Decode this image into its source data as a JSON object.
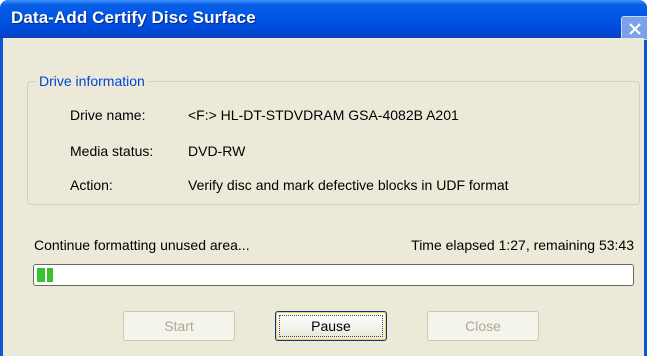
{
  "window": {
    "title": "Data-Add Certify Disc Surface"
  },
  "drive_info": {
    "legend": "Drive information",
    "drive_name_label": "Drive name:",
    "drive_name_value": "<F:> HL-DT-STDVDRAM GSA-4082B A201",
    "media_status_label": "Media status:",
    "media_status_value": "DVD-RW",
    "action_label": "Action:",
    "action_value": "Verify disc and mark defective blocks in UDF format"
  },
  "progress": {
    "status_text": "Continue formatting unused area...",
    "time_text": "Time elapsed 1:27, remaining 53:43",
    "fraction": 0.027
  },
  "buttons": {
    "start": "Start",
    "pause": "Pause",
    "close": "Close"
  },
  "icons": {
    "close": "close-icon"
  },
  "colors": {
    "title_bar": "#0055e5",
    "group_legend": "#0046d5",
    "progress_fill": "#39c12f"
  }
}
